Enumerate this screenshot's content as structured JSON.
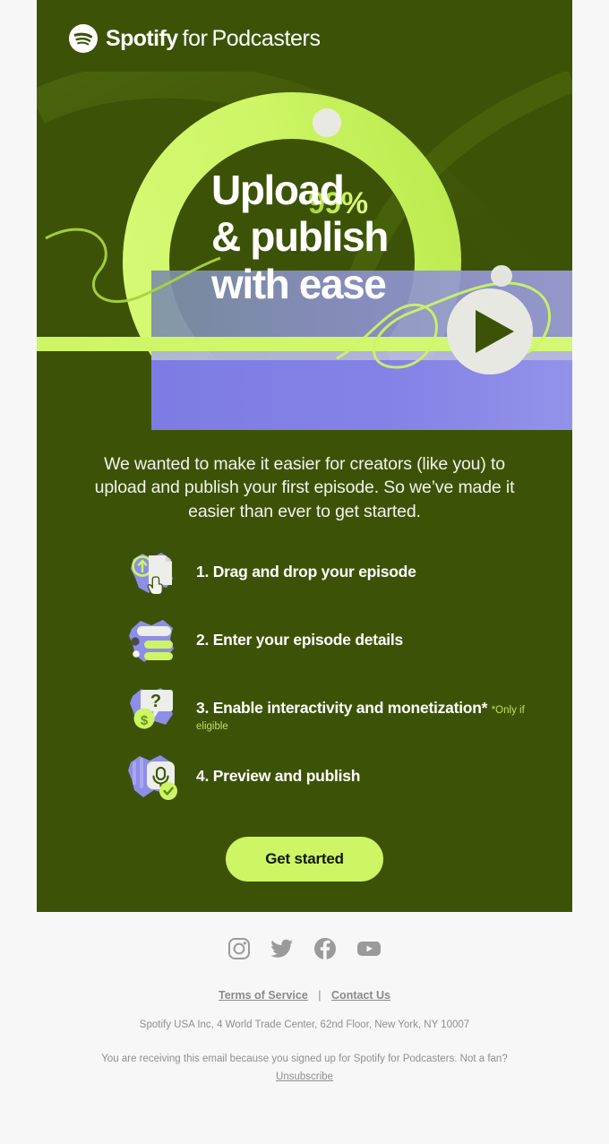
{
  "brand": {
    "logo_icon": "spotify-logo-icon",
    "name_bold": "Spotify",
    "name_for": "for",
    "name_product": "Podcasters",
    "colors": {
      "card_background": "#3c5307",
      "lime": "#cdf564",
      "purple": "#7b7be0",
      "offwhite": "#e8e8e2",
      "page_background": "#f7f7f7"
    }
  },
  "hero": {
    "percent_label": "99%",
    "heading_lines": [
      "Upload",
      "& publish",
      "with ease"
    ],
    "play_icon": "play-icon",
    "ring_icon": "progress-ring-icon"
  },
  "intro": {
    "paragraph": "We wanted to make it easier for creators (like you) to upload and publish your first episode. So we’ve made it easier than ever to get started."
  },
  "steps": [
    {
      "icon": "drag-drop-document-icon",
      "title": "1. Drag and drop your episode",
      "note": ""
    },
    {
      "icon": "episode-details-form-icon",
      "title": "2. Enter your episode details",
      "note": ""
    },
    {
      "icon": "interactivity-monetization-icon",
      "title": "3. Enable interactivity and monetization*",
      "note": "*Only if eligible"
    },
    {
      "icon": "preview-publish-microphone-icon",
      "title": "4. Preview and publish",
      "note": ""
    }
  ],
  "cta": {
    "label": "Get started"
  },
  "footer": {
    "socials": [
      {
        "name": "instagram-icon",
        "label": "Instagram"
      },
      {
        "name": "twitter-icon",
        "label": "Twitter"
      },
      {
        "name": "facebook-icon",
        "label": "Facebook"
      },
      {
        "name": "youtube-icon",
        "label": "YouTube"
      }
    ],
    "terms_label": "Terms of Service",
    "separator": "|",
    "contact_label": "Contact Us",
    "address": "Spotify USA Inc, 4 World Trade Center, 62nd Floor, New York, NY 10007",
    "legal_text": "You are receiving this email because you signed up for Spotify for Podcasters. Not a fan?",
    "unsubscribe_label": "Unsubscribe"
  }
}
